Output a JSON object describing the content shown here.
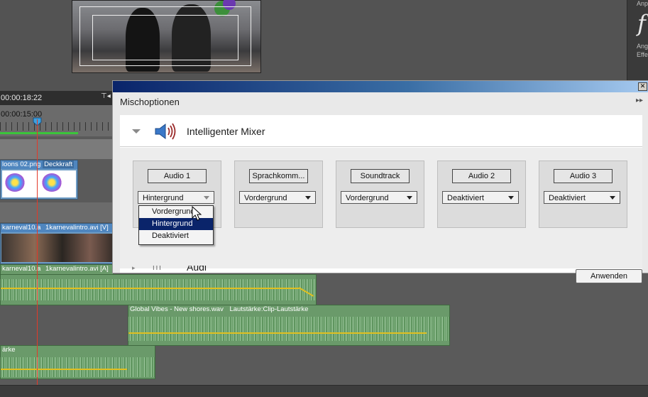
{
  "app": {
    "timecode": "00:00:18:22",
    "ruler_time": "00:00:15:00",
    "right_panel": {
      "glyph": "f",
      "label_1": "Anp",
      "label_2": "Ang",
      "label_3": "Effe"
    }
  },
  "timeline": {
    "video_clips": [
      {
        "label": "loons 02.png",
        "extra": "Deckkraft"
      },
      {
        "label": "karneval10.a",
        "extra": "1karnevalintro.avi [V]"
      },
      {
        "label": "karneval10.a",
        "extra": "1karnevalintro.avi [A]"
      }
    ],
    "audio_clips": [
      {
        "label": "Global Vibes - New shores.wav",
        "extra": "Lautstärke:Clip-Lautstärke"
      },
      {
        "label": "ärke"
      }
    ]
  },
  "dialog": {
    "close_glyph": "✕",
    "title": "Mischoptionen",
    "collapse_glyph": "▸▸",
    "section_title": "Intelligenter Mixer",
    "next_section_partial": "Audi",
    "channels": [
      {
        "name": "Audio 1",
        "mode": "Hintergrund"
      },
      {
        "name": "Sprachkomm...",
        "mode": "Vordergrund"
      },
      {
        "name": "Soundtrack",
        "mode": "Vordergrund"
      },
      {
        "name": "Audio 2",
        "mode": "Deaktiviert"
      },
      {
        "name": "Audio 3",
        "mode": "Deaktiviert"
      }
    ],
    "dropdown_options": [
      "Vordergrund",
      "Hintergrund",
      "Deaktiviert"
    ],
    "dropdown_selected_index": 1,
    "apply_label": "Anwenden"
  },
  "colors": {
    "titlebar_start": "#0a246a",
    "selection": "#0a246a",
    "playhead": "#e23a2a",
    "audio_clip": "#6a9a6a",
    "video_clip": "#4f86bf"
  }
}
